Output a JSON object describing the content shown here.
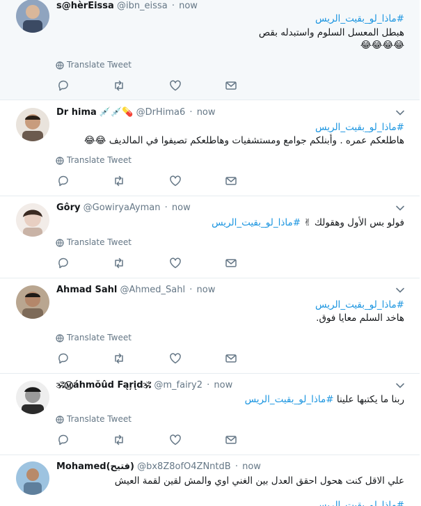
{
  "timeline": {
    "translate_label": "Translate Tweet",
    "tweets": [
      {
        "name": "s@hèrEissa",
        "name_emoji": "",
        "handle": "@ibn_eissa",
        "time": "now",
        "hashtag": "#ماذا_لو_بقيت_الريس",
        "lines": [
          "هبطل المعسل السلوم واستبدله بقص",
          "😂😂😂😂"
        ],
        "avatar_color": "#3b4a63"
      },
      {
        "name": "Dr hima",
        "name_emoji": "💉💉💊",
        "handle": "@DrHima6",
        "time": "now",
        "hashtag": "#ماذا_لو_بقيت_الريس",
        "lines": [
          "هاطلعكم عمره . وأبنلكم جوامع ومستشفيات وهاطلعكم تصيفوا في المالديف 😂😂"
        ],
        "avatar_color": "#6b5a4e"
      },
      {
        "name": "Gôry",
        "name_emoji": "",
        "handle": "@GowiryaAyman",
        "time": "now",
        "hashtag": "#ماذا_لو_بقيت_الريس",
        "lines": [
          "فولو بس الأول وهقولك ✌"
        ],
        "avatar_color": "#c9b3a6"
      },
      {
        "name": "Ahmad Sahl",
        "name_emoji": "",
        "handle": "@Ahmed_Sahl",
        "time": "now",
        "hashtag": "#ماذا_لو_بقيت_الريس",
        "lines": [
          "هاخد السلم معايا فوق."
        ],
        "avatar_color": "#7d6a58"
      },
      {
        "name": "🕉Ⓜáhmŏûd Fąŗįd🕉",
        "name_emoji": "",
        "handle": "@m_fairy2",
        "time": "now",
        "hashtag": "#ماذا_لو_بقيت_الريس",
        "lines": [
          "ربنا ما يكتبها علينا"
        ],
        "avatar_color": "#2b2b2b"
      },
      {
        "name": "Mohamed(فتيح)",
        "name_emoji": "",
        "handle": "@bx8Z8ofO4ZNntdB",
        "time": "now",
        "hashtag": "#ماذا_لو_بقيت_الريس",
        "lines": [
          "علي الاقل كنت هحول احقق العدل بين الغني اوي والمش لقين لقمة العيش"
        ],
        "avatar_color": "#5f7f9c"
      }
    ]
  }
}
